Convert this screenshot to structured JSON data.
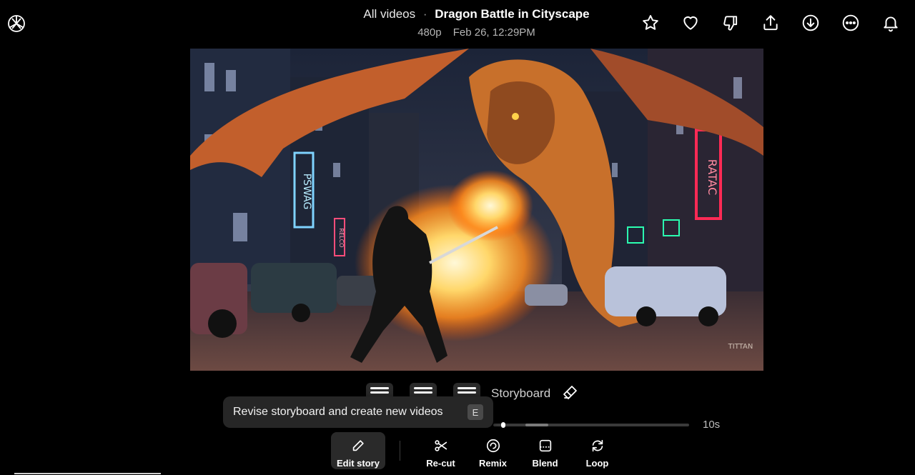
{
  "header": {
    "breadcrumb": "All videos",
    "separator": "·",
    "title": "Dragon Battle in Cityscape",
    "resolution": "480p",
    "timestamp": "Feb 26, 12:29PM"
  },
  "actions": [
    {
      "icon": "star-icon"
    },
    {
      "icon": "heart-icon"
    },
    {
      "icon": "thumbs-down-icon"
    },
    {
      "icon": "share-icon"
    },
    {
      "icon": "download-icon"
    },
    {
      "icon": "more-icon"
    },
    {
      "icon": "bell-icon"
    }
  ],
  "video": {
    "sign_left_1": "PSWAG",
    "sign_left_2": "RELCO",
    "sign_right_1": "RATAC",
    "watermark": "TITTAN"
  },
  "storyboard": {
    "label": "Storyboard",
    "thumbs": 3
  },
  "tooltip": {
    "text": "Revise storyboard and create new videos",
    "shortcut": "E"
  },
  "timeline": {
    "duration": "10s"
  },
  "toolbar": {
    "edit_story": "Edit story",
    "recut": "Re-cut",
    "remix": "Remix",
    "blend": "Blend",
    "loop": "Loop"
  }
}
